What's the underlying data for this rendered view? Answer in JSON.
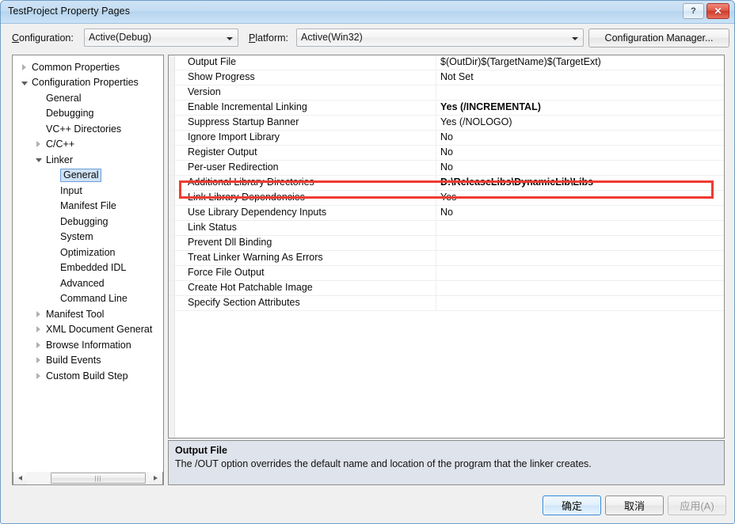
{
  "window": {
    "title": "TestProject Property Pages",
    "help_button": "?",
    "close_button": "✕"
  },
  "config_bar": {
    "configuration_label": "Configuration:",
    "configuration_value": "Active(Debug)",
    "platform_label": "Platform:",
    "platform_value": "Active(Win32)",
    "configuration_manager_button": "Configuration Manager..."
  },
  "tree": {
    "items": [
      {
        "label": "Common Properties",
        "indent": 0,
        "state": "collapsed",
        "selected": false
      },
      {
        "label": "Configuration Properties",
        "indent": 0,
        "state": "expanded",
        "selected": false
      },
      {
        "label": "General",
        "indent": 1,
        "state": "leaf",
        "selected": false
      },
      {
        "label": "Debugging",
        "indent": 1,
        "state": "leaf",
        "selected": false
      },
      {
        "label": "VC++ Directories",
        "indent": 1,
        "state": "leaf",
        "selected": false
      },
      {
        "label": "C/C++",
        "indent": 1,
        "state": "collapsed",
        "selected": false
      },
      {
        "label": "Linker",
        "indent": 1,
        "state": "expanded",
        "selected": false
      },
      {
        "label": "General",
        "indent": 2,
        "state": "leaf",
        "selected": true
      },
      {
        "label": "Input",
        "indent": 2,
        "state": "leaf",
        "selected": false
      },
      {
        "label": "Manifest File",
        "indent": 2,
        "state": "leaf",
        "selected": false
      },
      {
        "label": "Debugging",
        "indent": 2,
        "state": "leaf",
        "selected": false
      },
      {
        "label": "System",
        "indent": 2,
        "state": "leaf",
        "selected": false
      },
      {
        "label": "Optimization",
        "indent": 2,
        "state": "leaf",
        "selected": false
      },
      {
        "label": "Embedded IDL",
        "indent": 2,
        "state": "leaf",
        "selected": false
      },
      {
        "label": "Advanced",
        "indent": 2,
        "state": "leaf",
        "selected": false
      },
      {
        "label": "Command Line",
        "indent": 2,
        "state": "leaf",
        "selected": false
      },
      {
        "label": "Manifest Tool",
        "indent": 1,
        "state": "collapsed",
        "selected": false
      },
      {
        "label": "XML Document Generat",
        "indent": 1,
        "state": "collapsed",
        "selected": false
      },
      {
        "label": "Browse Information",
        "indent": 1,
        "state": "collapsed",
        "selected": false
      },
      {
        "label": "Build Events",
        "indent": 1,
        "state": "collapsed",
        "selected": false
      },
      {
        "label": "Custom Build Step",
        "indent": 1,
        "state": "collapsed",
        "selected": false
      }
    ],
    "scrollbar": {
      "left_arrow": "◄",
      "right_arrow": "►",
      "grip": "|||"
    }
  },
  "grid": {
    "rows": [
      {
        "name": "Output File",
        "value": "$(OutDir)$(TargetName)$(TargetExt)",
        "bold": false,
        "highlighted": false
      },
      {
        "name": "Show Progress",
        "value": "Not Set",
        "bold": false,
        "highlighted": false
      },
      {
        "name": "Version",
        "value": "",
        "bold": false,
        "highlighted": false
      },
      {
        "name": "Enable Incremental Linking",
        "value": "Yes (/INCREMENTAL)",
        "bold": true,
        "highlighted": false
      },
      {
        "name": "Suppress Startup Banner",
        "value": "Yes (/NOLOGO)",
        "bold": false,
        "highlighted": false
      },
      {
        "name": "Ignore Import Library",
        "value": "No",
        "bold": false,
        "highlighted": false
      },
      {
        "name": "Register Output",
        "value": "No",
        "bold": false,
        "highlighted": false
      },
      {
        "name": "Per-user Redirection",
        "value": "No",
        "bold": false,
        "highlighted": false
      },
      {
        "name": "Additional Library Directories",
        "value": "D:\\ReleaseLibs\\DynamicLib\\Libs",
        "bold": true,
        "highlighted": true
      },
      {
        "name": "Link Library Dependencies",
        "value": "Yes",
        "bold": false,
        "highlighted": false
      },
      {
        "name": "Use Library Dependency Inputs",
        "value": "No",
        "bold": false,
        "highlighted": false
      },
      {
        "name": "Link Status",
        "value": "",
        "bold": false,
        "highlighted": false
      },
      {
        "name": "Prevent Dll Binding",
        "value": "",
        "bold": false,
        "highlighted": false
      },
      {
        "name": "Treat Linker Warning As Errors",
        "value": "",
        "bold": false,
        "highlighted": false
      },
      {
        "name": "Force File Output",
        "value": "",
        "bold": false,
        "highlighted": false
      },
      {
        "name": "Create Hot Patchable Image",
        "value": "",
        "bold": false,
        "highlighted": false
      },
      {
        "name": "Specify Section Attributes",
        "value": "",
        "bold": false,
        "highlighted": false
      }
    ],
    "highlight_color": "#f03b30"
  },
  "description": {
    "title": "Output File",
    "body": "The /OUT option overrides the default name and location of the program that the linker creates."
  },
  "footer": {
    "ok_button": "确定",
    "cancel_button": "取消",
    "apply_button": "应用(A)"
  }
}
